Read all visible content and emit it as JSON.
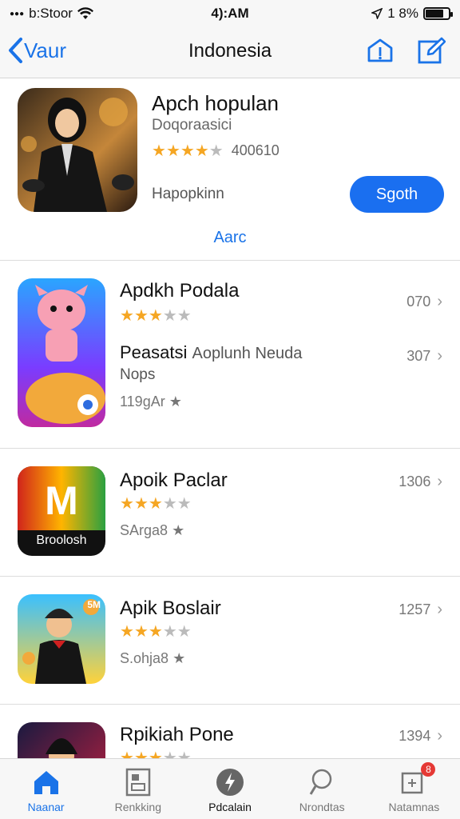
{
  "status": {
    "carrier": "b:Stoor",
    "time": "4):AM",
    "battery": "1 8%",
    "battery_level": 0.8
  },
  "nav": {
    "back_label": "Vaur",
    "title": "Indonesia"
  },
  "featured": {
    "title": "Apch hopulan",
    "subtitle": "Doqoraasici",
    "rating": 4,
    "rating_count": "400610",
    "description": "Hapopkinn",
    "get_label": "Sgoth",
    "more_label": "Aarc"
  },
  "apps": [
    {
      "title": "Apdkh Podala",
      "rating": 3,
      "number": "070",
      "line2": "Peasatsi",
      "line2b": "Aoplunh Neuda",
      "line2_number": "307",
      "line3": "Nops",
      "line4": "119gAr"
    },
    {
      "title": "Apoik Paclar",
      "rating": 3,
      "number": "1306",
      "line": "SArga8",
      "icon_text": "Broolosh",
      "icon_letter": "M"
    },
    {
      "title": "Apik Boslair",
      "rating": 3,
      "number": "1257",
      "line": "S.ohja8",
      "icon_text": "5M"
    },
    {
      "title": "Rpikiah Pone",
      "rating": 3,
      "number": "1394"
    }
  ],
  "tabs": [
    {
      "label": "Naanar",
      "icon": "home-icon"
    },
    {
      "label": "Renkking",
      "icon": "ranking-icon"
    },
    {
      "label": "Pdcalain",
      "icon": "lightning-icon"
    },
    {
      "label": "Nrondtas",
      "icon": "search-icon"
    },
    {
      "label": "Natamnas",
      "icon": "updates-icon",
      "badge": "8"
    }
  ]
}
